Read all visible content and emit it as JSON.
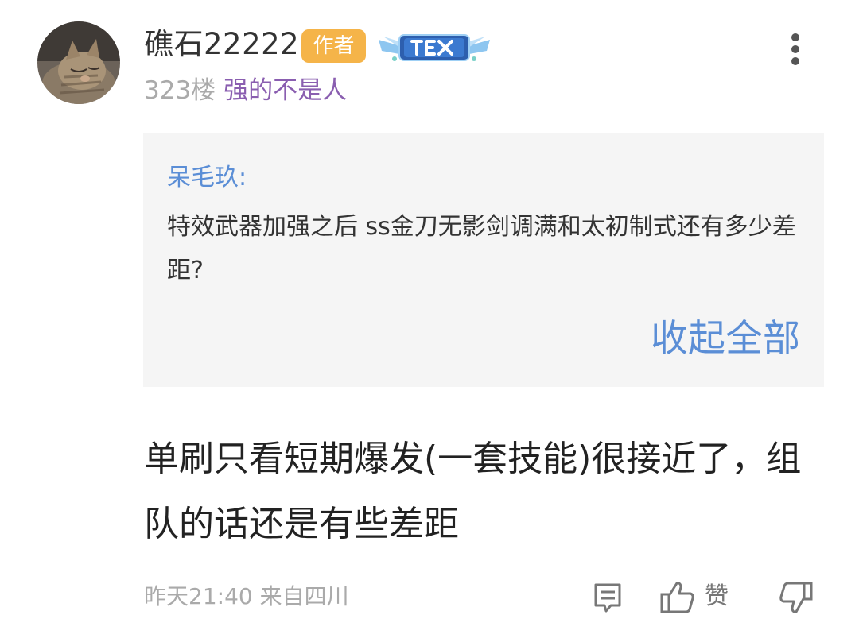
{
  "post": {
    "username": "礁石22222",
    "author_badge": "作者",
    "floor": "323楼",
    "tail_title": "强的不是人",
    "more_icon": "more-vertical-icon"
  },
  "quote": {
    "author": "呆毛玖:",
    "text": "特效武器加强之后 ss金刀无影剑调满和太初制式还有多少差距?",
    "collapse_label": "收起全部"
  },
  "reply": {
    "text": "单刷只看短期爆发(一套技能)很接近了，组队的话还是有些差距"
  },
  "footer": {
    "time_location": "昨天21:40 来自四川",
    "like_label": "赞",
    "icons": [
      "comment-icon",
      "thumbs-up-icon",
      "thumbs-down-icon"
    ]
  },
  "colors": {
    "author_badge_bg": "#f5b449",
    "link_blue": "#5b8ed6",
    "tail_purple": "#8a5eb0",
    "quote_bg": "#f5f5f5"
  }
}
